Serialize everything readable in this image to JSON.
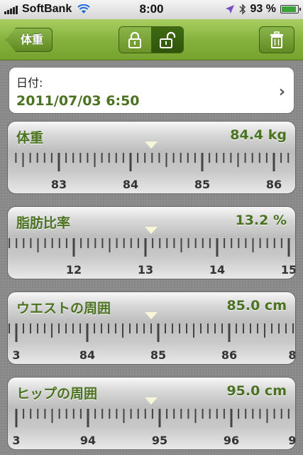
{
  "status_bar": {
    "carrier": "SoftBank",
    "time": "8:00",
    "battery": "93 %",
    "battery_level": 0.93
  },
  "nav": {
    "back_label": "体重",
    "lock_icon": "lock-closed-icon",
    "unlock_icon": "lock-open-icon",
    "trash_icon": "trash-icon"
  },
  "date": {
    "label": "日付:",
    "value": "2011/07/03 6:50"
  },
  "measurements": [
    {
      "label": "体重",
      "value": "84.4 kg",
      "current": 84.4,
      "ticks": [
        "83",
        "84",
        "85",
        "86"
      ]
    },
    {
      "label": "脂肪比率",
      "value": "13.2 %",
      "current": 13.2,
      "ticks": [
        "12",
        "13",
        "14",
        "15"
      ]
    },
    {
      "label": "ウエストの周囲",
      "value": "85.0 cm",
      "current": 85.0,
      "ticks": [
        "3",
        "84",
        "85",
        "86",
        "8"
      ]
    },
    {
      "label": "ヒップの周囲",
      "value": "95.0 cm",
      "current": 95.0,
      "ticks": [
        "3",
        "94",
        "95",
        "96",
        "9"
      ]
    }
  ],
  "colors": {
    "accent": "#4b7220",
    "nav": "#86b33e"
  }
}
